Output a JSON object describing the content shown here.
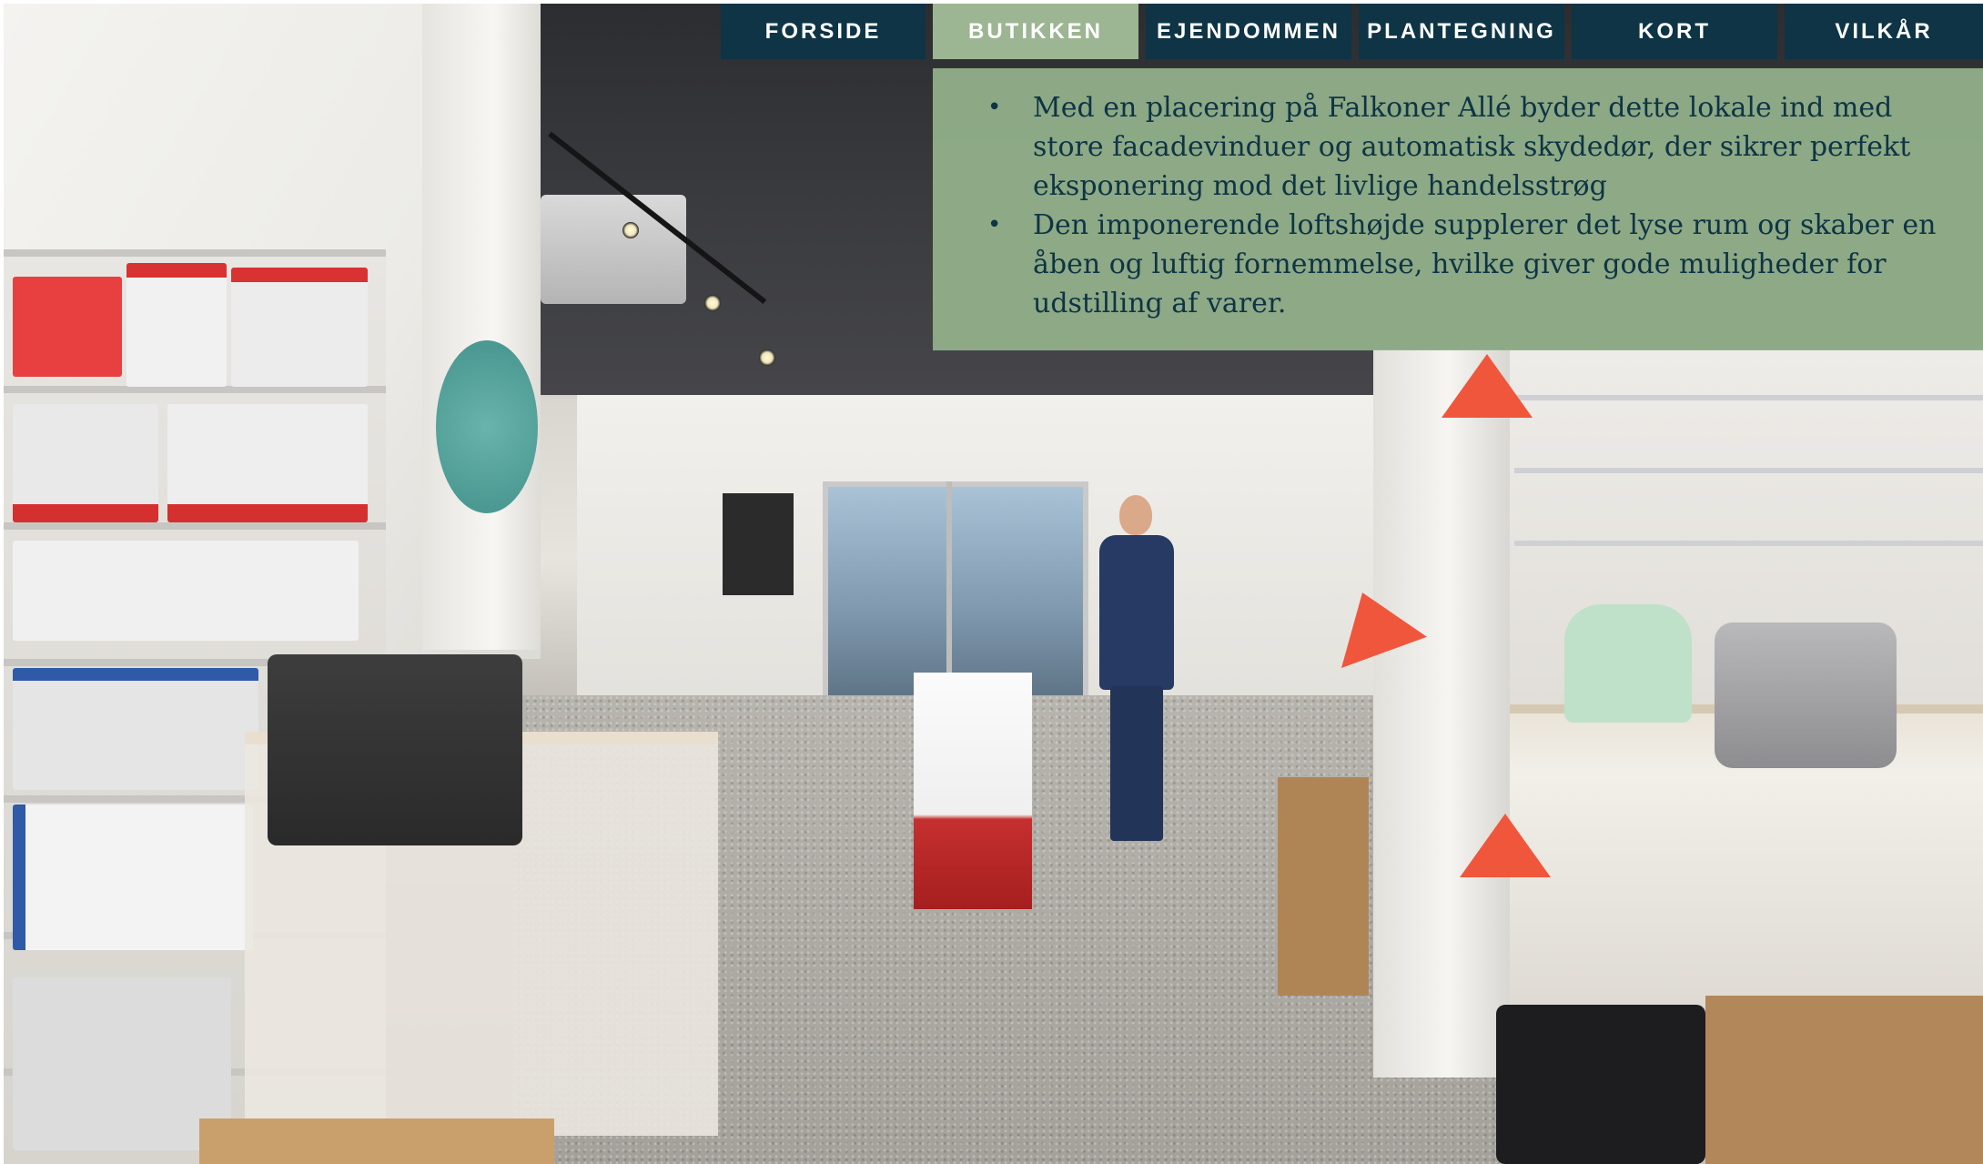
{
  "nav": {
    "items": [
      {
        "label": "FORSIDE",
        "active": false
      },
      {
        "label": "BUTIKKEN",
        "active": true
      },
      {
        "label": "EJENDOMMEN",
        "active": false
      },
      {
        "label": "PLANTEGNING",
        "active": false
      },
      {
        "label": "KORT",
        "active": false
      },
      {
        "label": "VILKÅR",
        "active": false
      }
    ]
  },
  "info": {
    "bullets": [
      "Med en placering på Falkoner Allé byder dette lokale ind med store facadevinduer og automatisk skydedør, der sikrer perfekt eksponering mod det livlige handelsstrøg",
      "Den imponerende loftshøjde supplerer det lyse rum og skaber en åben og luftig fornemmelse, hvilke giver gode muligheder for udstilling af varer."
    ],
    "bullet_symbol": "•"
  },
  "photo": {
    "description_icon": "store-interior-photo"
  },
  "colors": {
    "nav_bg": "#0e3445",
    "nav_active_bg": "#9cb592",
    "panel_bg": "#93b18b",
    "panel_text": "#0e3445"
  }
}
